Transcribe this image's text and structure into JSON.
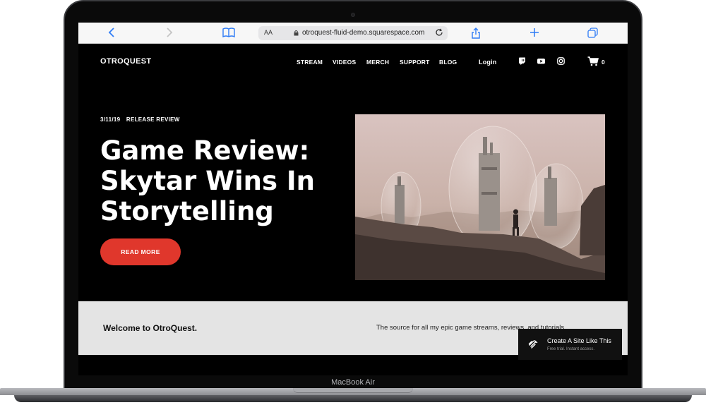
{
  "device": {
    "model_label": "MacBook Air"
  },
  "browser": {
    "aa_label": "AA",
    "url": "otroquest-fluid-demo.squarespace.com",
    "icons": [
      "chevron-left-icon",
      "chevron-right-icon",
      "bookmarks-icon",
      "lock-icon",
      "reload-icon",
      "share-icon",
      "plus-icon",
      "tabs-icon"
    ]
  },
  "header": {
    "brand": "OTROQUEST",
    "nav": [
      "STREAM",
      "VIDEOS",
      "MERCH",
      "SUPPORT",
      "BLOG"
    ],
    "login": "Login",
    "social_icons": [
      "twitch-icon",
      "youtube-icon",
      "instagram-icon"
    ],
    "cart_count": "0"
  },
  "hero": {
    "date": "3/11/19",
    "category": "RELEASE REVIEW",
    "title": "Game Review: Skytar Wins In Storytelling",
    "cta": "READ MORE"
  },
  "welcome": {
    "title": "Welcome to OtroQuest.",
    "subtitle": "The source for all my epic game streams, reviews, and tutorials."
  },
  "badge": {
    "title": "Create A Site Like This",
    "subtitle": "Free trial. Instant access."
  },
  "colors": {
    "accent": "#e0372c",
    "page_bg": "#000000",
    "strip_bg": "#e4e4e4",
    "link_blue": "#2f7cf6"
  }
}
